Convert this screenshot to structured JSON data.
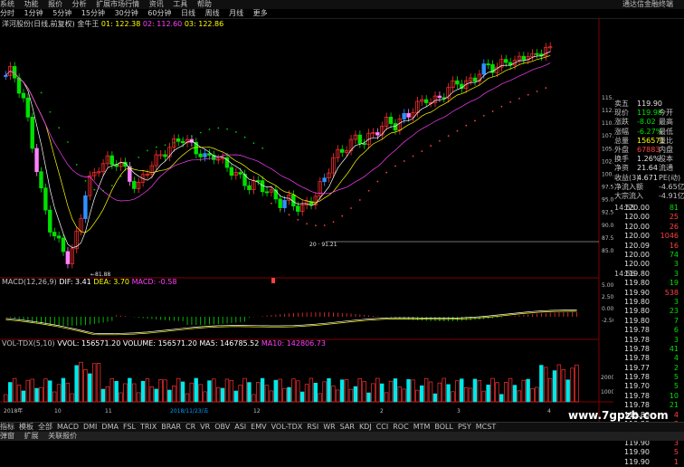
{
  "menubar": {
    "items": [
      "系统",
      "功能",
      "报价",
      "分析",
      "扩展市场行情",
      "资讯",
      "工具",
      "帮助"
    ],
    "right_title": "通达信金融终端"
  },
  "periodbar": {
    "items": [
      "分时",
      "1分钟",
      "5分钟",
      "15分钟",
      "30分钟",
      "60分钟",
      "日线",
      "周线",
      "月线",
      "更多"
    ]
  },
  "info": {
    "stock": "洋河股份(日线,前复权)",
    "indicator": "金牛王",
    "v1": "01: 122.38",
    "v2": "02: 112.60",
    "v3": "03: 122.86"
  },
  "annotations": {
    "low_label": "←81.88",
    "low_label2": "←91.21",
    "mid_label": "20 · 91.21",
    "marker_b": "B"
  },
  "macd": {
    "name": "MACD(12,26,9)",
    "dif": "DIF: 3.41",
    "dea": "DEA: 3.70",
    "macd": "MACD: -0.58",
    "axis": [
      "5.00",
      "2.50",
      "0.00",
      "-2.50"
    ]
  },
  "vol": {
    "name": "VOL-TDX(5,10)",
    "vvol": "VVOL: 156571.20",
    "volume": "VOLUME: 156571.20",
    "ma5": "MA5: 146785.52",
    "ma10": "MA10: 142806.73",
    "axis": [
      "20000",
      "10000"
    ]
  },
  "price_axis": [
    "115.0",
    "112.5",
    "110.0",
    "107.5",
    "105.0",
    "102.5",
    "100.0",
    "97.50",
    "95.00",
    "92.50",
    "90.00",
    "87.50",
    "85.00"
  ],
  "quote": {
    "rows": [
      {
        "l": "卖五",
        "v": "119.90",
        "vc": "white",
        "l2": ""
      },
      {
        "l": "现价",
        "v": "119.98",
        "vc": "green",
        "l2": "今开"
      },
      {
        "l": "涨跌",
        "v": "-8.02",
        "vc": "green",
        "l2": "最高"
      },
      {
        "l": "涨幅",
        "v": "-6.27%",
        "vc": "green",
        "l2": "最低"
      },
      {
        "l": "总量",
        "v": "156571",
        "vc": "yellow",
        "l2": "量比"
      },
      {
        "l": "外盘",
        "v": "67883",
        "vc": "red",
        "l2": "内盘"
      },
      {
        "l": "换手",
        "v": "1.26%",
        "vc": "white",
        "l2": "股本"
      },
      {
        "l": "净资",
        "v": "21.64",
        "vc": "white",
        "l2": "流通"
      },
      {
        "l": "收益(3)",
        "v": "4.671",
        "vc": "white",
        "l2": "PE(动)"
      },
      {
        "l": "净流入额",
        "v": "",
        "vc": "white",
        "l2": "-4.65亿"
      },
      {
        "l": "大宗流入",
        "v": "",
        "vc": "white",
        "l2": "-4.91亿"
      }
    ],
    "ticks": [
      {
        "t": "14:55",
        "v": "120.00",
        "n": "81",
        "c": "green"
      },
      {
        "t": "",
        "v": "120.00",
        "n": "25",
        "c": "red"
      },
      {
        "t": "",
        "v": "120.00",
        "n": "26",
        "c": "red"
      },
      {
        "t": "",
        "v": "120.00",
        "n": "1046",
        "c": "red"
      },
      {
        "t": "",
        "v": "120.09",
        "n": "16",
        "c": "red"
      },
      {
        "t": "",
        "v": "120.00",
        "n": "74",
        "c": "green"
      },
      {
        "t": "",
        "v": "120.00",
        "n": "3",
        "c": "green"
      },
      {
        "t": "14:56",
        "v": "119.80",
        "n": "3",
        "c": "green"
      },
      {
        "t": "",
        "v": "119.80",
        "n": "19",
        "c": "green"
      },
      {
        "t": "",
        "v": "119.90",
        "n": "538",
        "c": "red"
      },
      {
        "t": "",
        "v": "119.80",
        "n": "3",
        "c": "green"
      },
      {
        "t": "",
        "v": "119.80",
        "n": "23",
        "c": "green"
      },
      {
        "t": "",
        "v": "119.80",
        "n": "7",
        "c": "green"
      },
      {
        "t": "",
        "v": "119.78",
        "n": "6",
        "c": "green"
      },
      {
        "t": "",
        "v": "119.78",
        "n": "3",
        "c": "green"
      },
      {
        "t": "",
        "v": "119.78",
        "n": "41",
        "c": "green"
      },
      {
        "t": "",
        "v": "119.78",
        "n": "4",
        "c": "green"
      },
      {
        "t": "",
        "v": "119.77",
        "n": "2",
        "c": "green"
      },
      {
        "t": "",
        "v": "119.78",
        "n": "5",
        "c": "green"
      },
      {
        "t": "",
        "v": "119.70",
        "n": "5",
        "c": "green"
      },
      {
        "t": "",
        "v": "119.78",
        "n": "10",
        "c": "green"
      },
      {
        "t": "",
        "v": "119.78",
        "n": "21",
        "c": "green"
      },
      {
        "t": "",
        "v": "119.80",
        "n": "4",
        "c": "red"
      },
      {
        "t": "",
        "v": "119.80",
        "n": "3",
        "c": "red"
      },
      {
        "t": "",
        "v": "119.91",
        "n": "13",
        "c": "red"
      },
      {
        "t": "",
        "v": "119.90",
        "n": "3",
        "c": "red"
      },
      {
        "t": "",
        "v": "119.90",
        "n": "5",
        "c": "red"
      },
      {
        "t": "",
        "v": "119.90",
        "n": "1",
        "c": "red"
      }
    ]
  },
  "time_axis": {
    "year": "2018年",
    "marker": "2018/11/23/五",
    "ticks": [
      "10",
      "11",
      "12",
      "2",
      "3",
      "4"
    ]
  },
  "bottombar": {
    "items": [
      "指标",
      "模板",
      "全部",
      "MACD",
      "DMI",
      "DMA",
      "FSL",
      "TRIX",
      "BRAR",
      "CR",
      "VR",
      "OBV",
      "ASI",
      "EMV",
      "VOL-TDX",
      "RSI",
      "WR",
      "SAR",
      "KDJ",
      "CCI",
      "ROC",
      "MTM",
      "BOLL",
      "PSY",
      "MCST"
    ]
  },
  "statusbar": {
    "items": [
      "弹窗",
      "扩展",
      "关联报价"
    ]
  },
  "watermark": "www.7gpzb.com",
  "colors": {
    "up": "#ff3030",
    "down": "#00e8e8",
    "green": "#00e000",
    "blue": "#3090ff",
    "pink": "#ff80ff",
    "yellow": "#ffff00",
    "sar": "#00c000"
  }
}
